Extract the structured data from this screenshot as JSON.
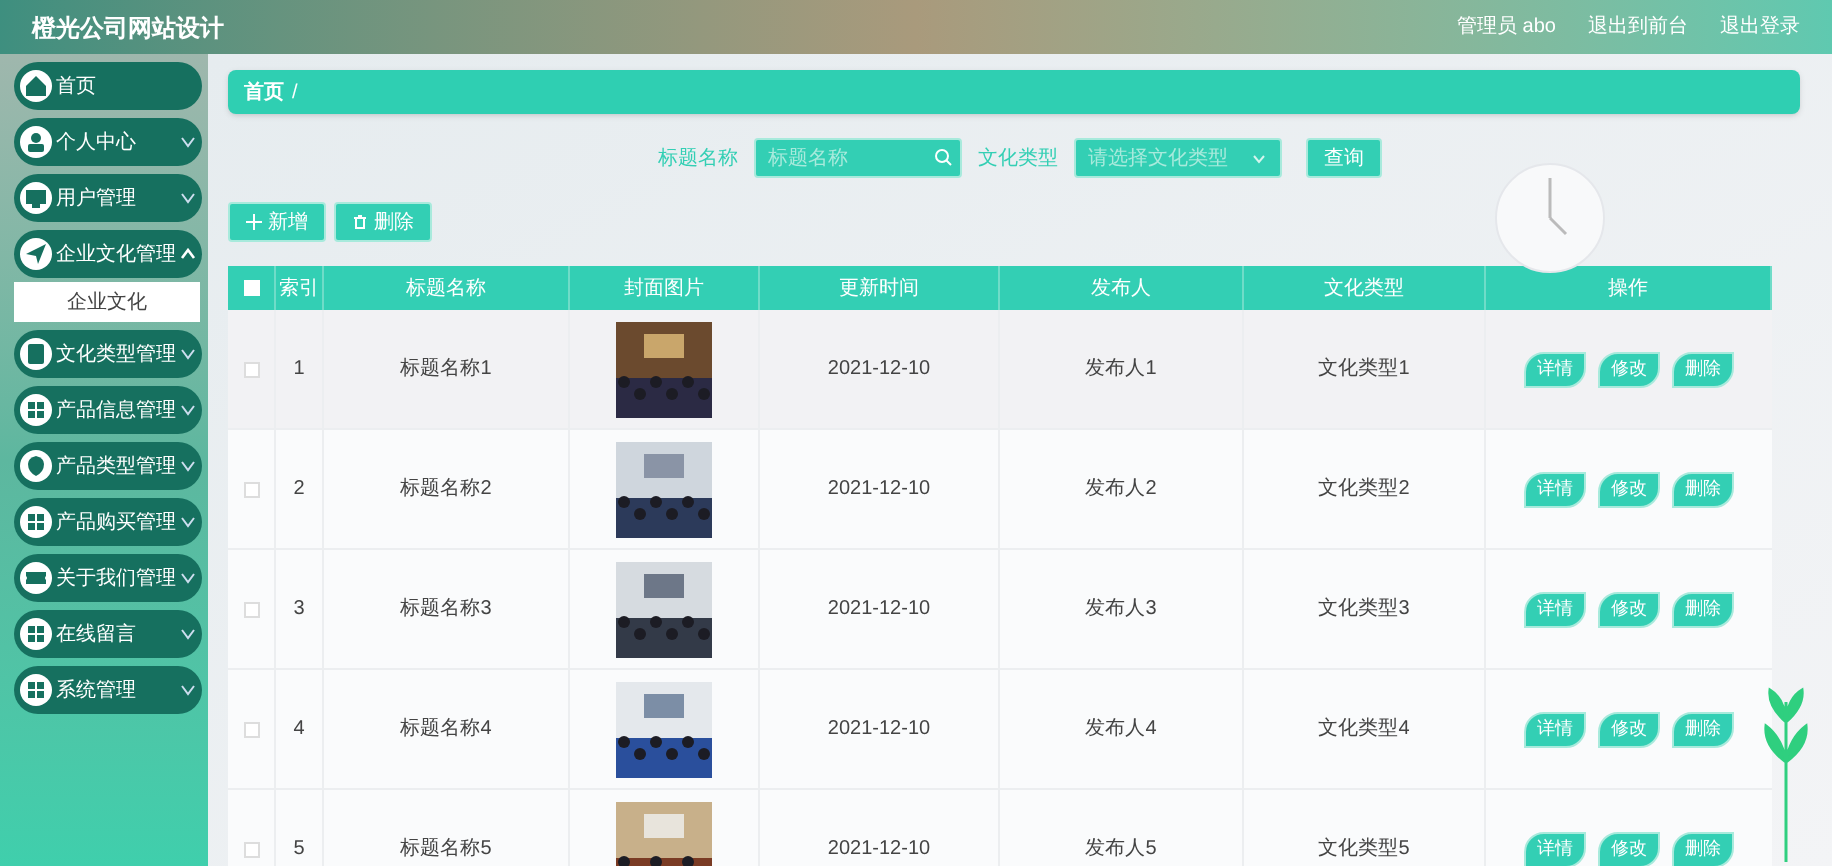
{
  "header": {
    "title": "橙光公司网站设计",
    "user": "管理员 abo",
    "links": [
      "退出到前台",
      "退出登录"
    ]
  },
  "sidebar": {
    "items": [
      {
        "label": "首页",
        "kind": "link"
      },
      {
        "label": "个人中心",
        "kind": "menu",
        "expanded": false
      },
      {
        "label": "用户管理",
        "kind": "menu",
        "expanded": false
      },
      {
        "label": "企业文化管理",
        "kind": "menu",
        "expanded": true,
        "children": [
          {
            "label": "企业文化",
            "selected": true
          }
        ]
      },
      {
        "label": "文化类型管理",
        "kind": "menu",
        "expanded": false
      },
      {
        "label": "产品信息管理",
        "kind": "menu",
        "expanded": false
      },
      {
        "label": "产品类型管理",
        "kind": "menu",
        "expanded": false
      },
      {
        "label": "产品购买管理",
        "kind": "menu",
        "expanded": false
      },
      {
        "label": "关于我们管理",
        "kind": "menu",
        "expanded": false
      },
      {
        "label": "在线留言",
        "kind": "menu",
        "expanded": false
      },
      {
        "label": "系统管理",
        "kind": "menu",
        "expanded": false
      }
    ]
  },
  "breadcrumb": {
    "home": "首页",
    "separator": "/"
  },
  "search": {
    "fields": [
      {
        "label": "标题名称",
        "kind": "text",
        "placeholder": "标题名称"
      },
      {
        "label": "文化类型",
        "kind": "select",
        "placeholder": "请选择文化类型"
      }
    ],
    "button": "查询"
  },
  "actions": [
    "新增",
    "删除"
  ],
  "table": {
    "select_all_checked": false,
    "columns": [
      "索引",
      "标题名称",
      "封面图片",
      "更新时间",
      "发布人",
      "文化类型",
      "操作"
    ],
    "rows": [
      {
        "checked": false,
        "index": "1",
        "title": "标题名称1",
        "time": "2021-12-10",
        "publisher": "发布人1",
        "type": "文化类型1",
        "buttons": [
          "详情",
          "修改",
          "删除"
        ]
      },
      {
        "checked": false,
        "index": "2",
        "title": "标题名称2",
        "time": "2021-12-10",
        "publisher": "发布人2",
        "type": "文化类型2",
        "buttons": [
          "详情",
          "修改",
          "删除"
        ]
      },
      {
        "checked": false,
        "index": "3",
        "title": "标题名称3",
        "time": "2021-12-10",
        "publisher": "发布人3",
        "type": "文化类型3",
        "buttons": [
          "详情",
          "修改",
          "删除"
        ]
      },
      {
        "checked": false,
        "index": "4",
        "title": "标题名称4",
        "time": "2021-12-10",
        "publisher": "发布人4",
        "type": "文化类型4",
        "buttons": [
          "详情",
          "修改",
          "删除"
        ]
      },
      {
        "checked": false,
        "index": "5",
        "title": "标题名称5",
        "time": "2021-12-10",
        "publisher": "发布人5",
        "type": "文化类型5",
        "buttons": [
          "详情",
          "修改",
          "删除"
        ]
      }
    ]
  }
}
